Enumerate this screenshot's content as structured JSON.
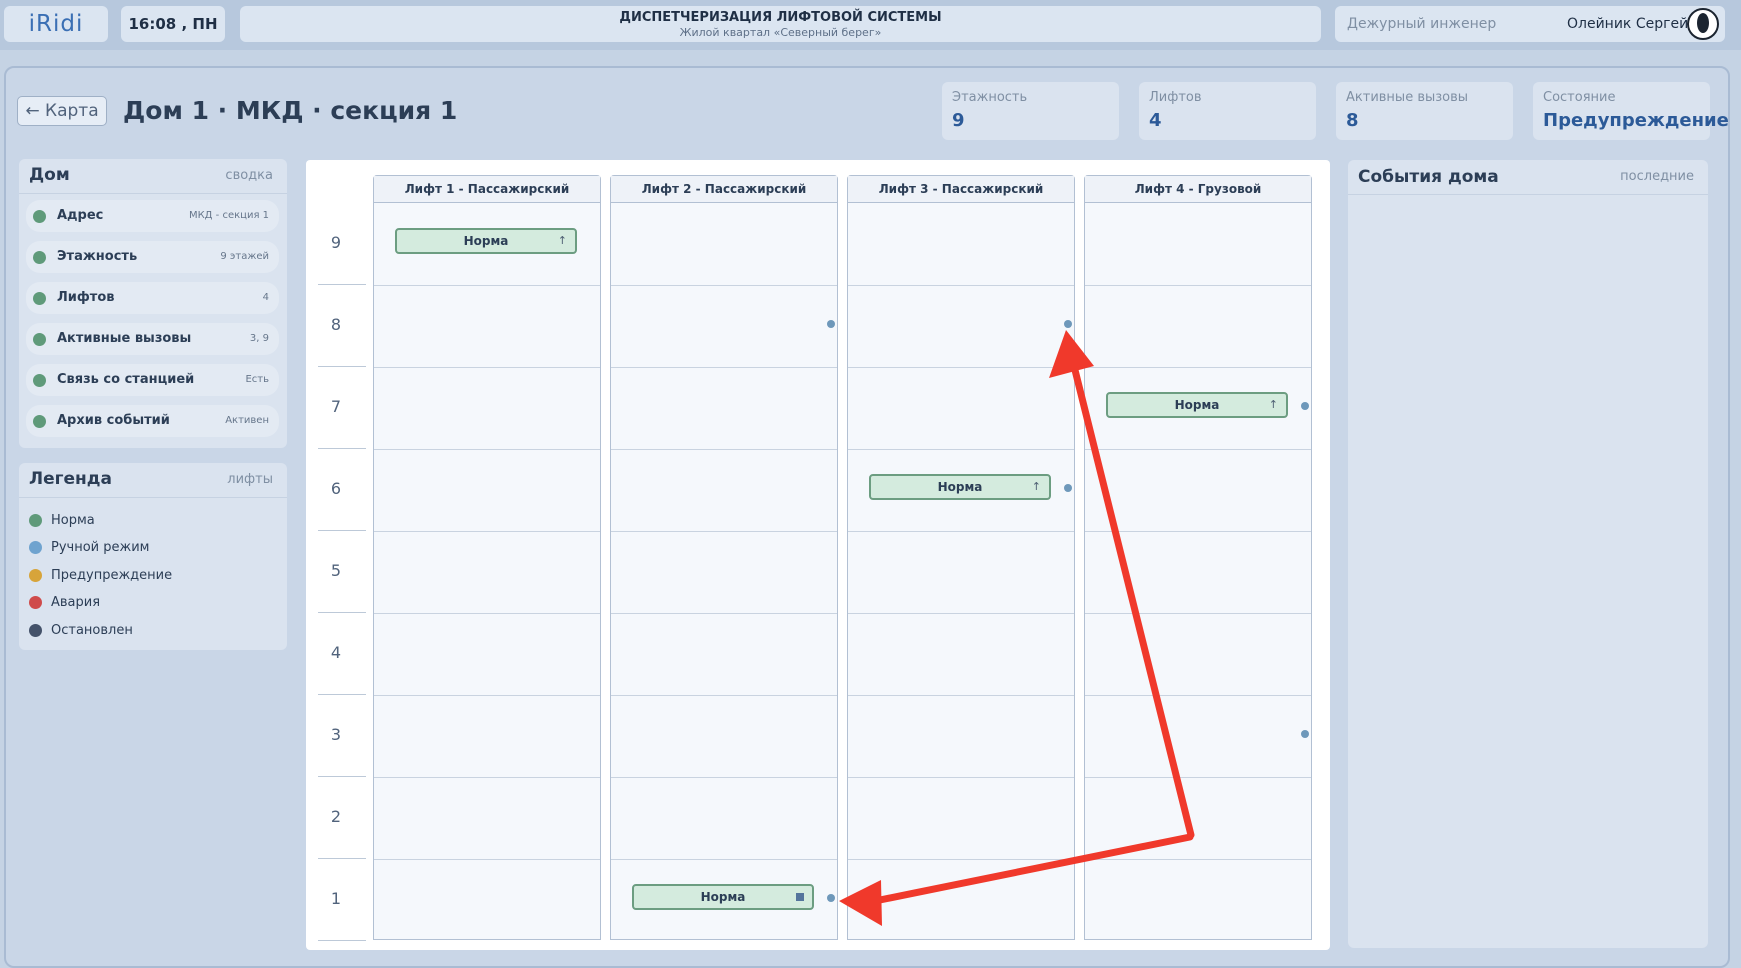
{
  "topbar": {
    "logo": "iRidi",
    "clock": "16:08 , ПН",
    "title": "ДИСПЕТЧЕРИЗАЦИЯ ЛИФТОВОЙ СИСТЕМЫ",
    "subtitle": "Жилой квартал «Северный берег»",
    "role": "Дежурный инженер",
    "user": "Олейник Сергей"
  },
  "header": {
    "back_label": "← Карта",
    "title": "Дом 1 · МКД · секция 1",
    "stats": [
      {
        "label": "Этажность",
        "value": "9"
      },
      {
        "label": "Лифтов",
        "value": "4"
      },
      {
        "label": "Активные вызовы",
        "value": "8"
      },
      {
        "label": "Состояние",
        "value": "Предупреждение"
      }
    ]
  },
  "house_panel": {
    "title": "Дом",
    "aside": "сводка",
    "rows": [
      {
        "name": "Адрес",
        "value": "МКД - секция 1",
        "status": "Норма"
      },
      {
        "name": "Этажность",
        "value": "9 этажей",
        "status": "Норма"
      },
      {
        "name": "Лифтов",
        "value": "4",
        "status": "Норма"
      },
      {
        "name": "Активные вызовы",
        "value": "3, 9",
        "status": "Норма"
      },
      {
        "name": "Связь со станцией",
        "value": "Есть",
        "status": "Норма"
      },
      {
        "name": "Архив событий",
        "value": "Активен",
        "status": "Норма"
      }
    ]
  },
  "legend": {
    "title": "Легенда",
    "aside": "лифты",
    "items": [
      {
        "name": "Норма",
        "color": "#5f9a7a"
      },
      {
        "name": "Ручной режим",
        "color": "#6fa3cf"
      },
      {
        "name": "Предупреждение",
        "color": "#d7a43a"
      },
      {
        "name": "Авария",
        "color": "#cf4b4b"
      },
      {
        "name": "Остановлен",
        "color": "#44526a"
      }
    ]
  },
  "floors": [
    "9",
    "8",
    "7",
    "6",
    "5",
    "4",
    "3",
    "2",
    "1"
  ],
  "elevators": [
    {
      "name": "Лифт 1 - Пассажирский",
      "floor": 9,
      "status": "Норма",
      "indicator": "↑",
      "calls": []
    },
    {
      "name": "Лифт 2 - Пассажирский",
      "floor": 1,
      "status": "Норма",
      "indicator": "stop",
      "calls": [
        8,
        1
      ]
    },
    {
      "name": "Лифт 3 - Пассажирский",
      "floor": 6,
      "status": "Норма",
      "indicator": "↑",
      "calls": [
        8,
        6
      ]
    },
    {
      "name": "Лифт 4 - Грузовой",
      "floor": 7,
      "status": "Норма",
      "indicator": "↑",
      "calls": [
        7,
        3
      ]
    }
  ],
  "events_panel": {
    "title": "События дома",
    "aside": "последние"
  },
  "colors": {
    "accent": "#2c5a98",
    "normal": "#5f9a7a",
    "call": "#6e98ba",
    "annotation": "#f0392b"
  }
}
